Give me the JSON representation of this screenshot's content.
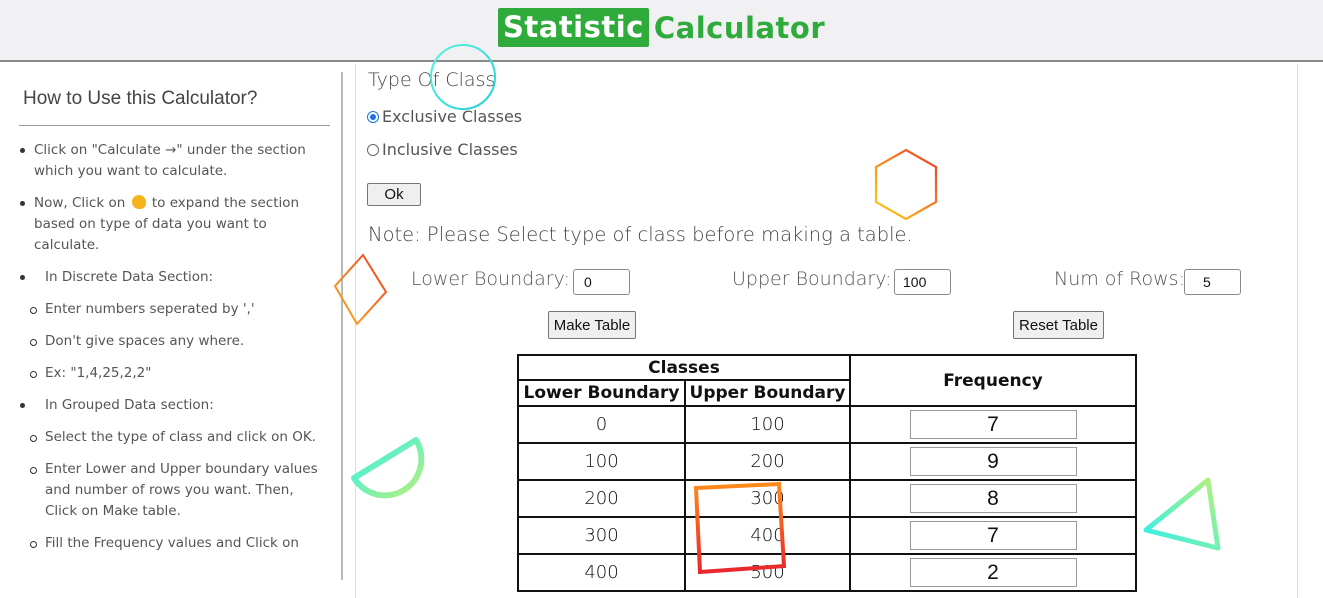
{
  "header": {
    "logo_part1": "Statistic",
    "logo_part2": "Calculator"
  },
  "sidebar": {
    "title": "How to Use this Calculator?",
    "items": [
      {
        "style": "bullet",
        "text": "Click on \"Calculate →\" under the section which you want to calculate."
      },
      {
        "style": "bullet",
        "text_before": "Now, Click on",
        "icon": "pointing-hand-icon",
        "text_after": "to expand the section based on type of data you want to calculate."
      },
      {
        "style": "bullet",
        "text": "In Discrete Data Section:"
      },
      {
        "style": "circle",
        "text": "Enter numbers seperated by ','"
      },
      {
        "style": "circle",
        "text": "Don't give spaces any where."
      },
      {
        "style": "circle",
        "text": "Ex: \"1,4,25,2,2\""
      },
      {
        "style": "bullet",
        "text": "In Grouped Data section:"
      },
      {
        "style": "circle",
        "text": "Select the type of class and click on OK."
      },
      {
        "style": "circle",
        "text": "Enter Lower and Upper boundary values and number of rows you want. Then, Click on Make table."
      },
      {
        "style": "circle",
        "text": "Fill the Frequency values and Click on"
      }
    ]
  },
  "class_type": {
    "title": "Type Of Class",
    "options": [
      {
        "label": "Exclusive Classes",
        "checked": true
      },
      {
        "label": "Inclusive Classes",
        "checked": false
      }
    ],
    "ok_label": "Ok"
  },
  "note": "Note: Please Select type of class before making a table.",
  "fields": {
    "lower_label": "Lower Boundary:",
    "lower_value": "0",
    "upper_label": "Upper Boundary:",
    "upper_value": "100",
    "rows_label": "Num of Rows:",
    "rows_value": "5"
  },
  "buttons": {
    "make_table": "Make Table",
    "reset_table": "Reset Table"
  },
  "table": {
    "header_classes": "Classes",
    "header_lower": "Lower Boundary",
    "header_upper": "Upper Boundary",
    "header_frequency": "Frequency",
    "rows": [
      {
        "lower": "0",
        "upper": "100",
        "frequency": "7"
      },
      {
        "lower": "100",
        "upper": "200",
        "frequency": "9"
      },
      {
        "lower": "200",
        "upper": "300",
        "frequency": "8"
      },
      {
        "lower": "300",
        "upper": "400",
        "frequency": "7"
      },
      {
        "lower": "400",
        "upper": "500",
        "frequency": "2"
      }
    ]
  },
  "colors": {
    "brand_green": "#2fab3c",
    "radio_blue": "#1a73e8"
  }
}
